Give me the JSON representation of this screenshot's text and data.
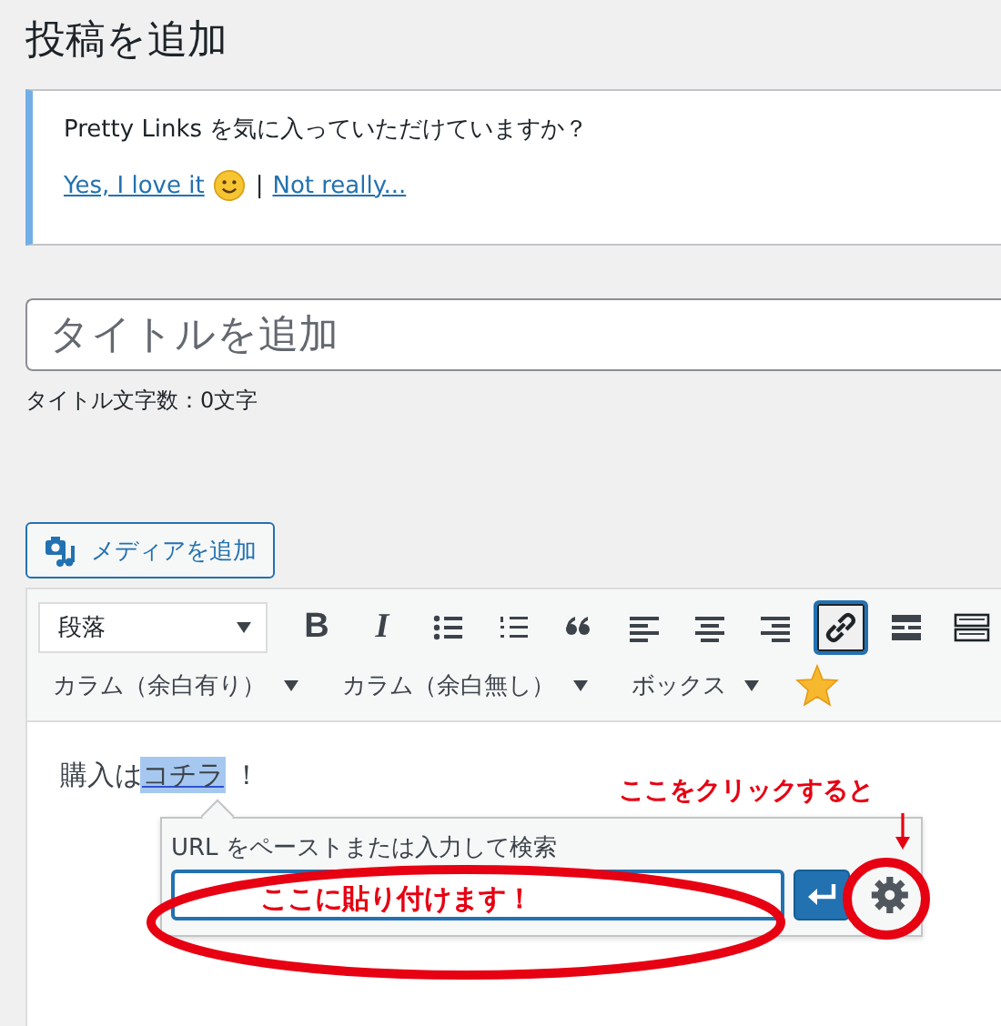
{
  "page": {
    "title": "投稿を追加"
  },
  "notice": {
    "message": "Pretty Links を気に入っていただけていますか？",
    "yes_link": "Yes, I love it",
    "separator": "|",
    "no_link": "Not really..."
  },
  "title_field": {
    "placeholder": "タイトルを追加"
  },
  "title_count": "タイトル文字数：0文字",
  "media_button": {
    "label": "メディアを追加"
  },
  "toolbar": {
    "format_select": {
      "value": "段落"
    },
    "tools": [
      {
        "kind": "bold",
        "label": "B",
        "selected": false
      },
      {
        "kind": "italic",
        "label": "I",
        "selected": false
      },
      {
        "kind": "bullet-list",
        "selected": false
      },
      {
        "kind": "numbered-list",
        "selected": false
      },
      {
        "kind": "quote",
        "selected": false
      },
      {
        "kind": "align-left",
        "selected": false
      },
      {
        "kind": "align-center",
        "selected": false
      },
      {
        "kind": "align-right",
        "selected": false
      },
      {
        "kind": "link",
        "selected": true
      },
      {
        "kind": "read-more",
        "selected": false
      },
      {
        "kind": "toolbar-toggle",
        "selected": false
      }
    ],
    "dropdowns": [
      {
        "label": "カラム（余白有り）"
      },
      {
        "label": "カラム（余白無し）"
      },
      {
        "label": "ボックス"
      }
    ]
  },
  "content": {
    "before": "購入は",
    "link": "コチラ",
    "after": "！",
    "link_highlighted": true
  },
  "link_popup": {
    "label": "URL をペーストまたは入力して検索"
  },
  "annotations": {
    "paste_note": "ここに貼り付けます！",
    "click_note": "ここをクリックすると"
  }
}
